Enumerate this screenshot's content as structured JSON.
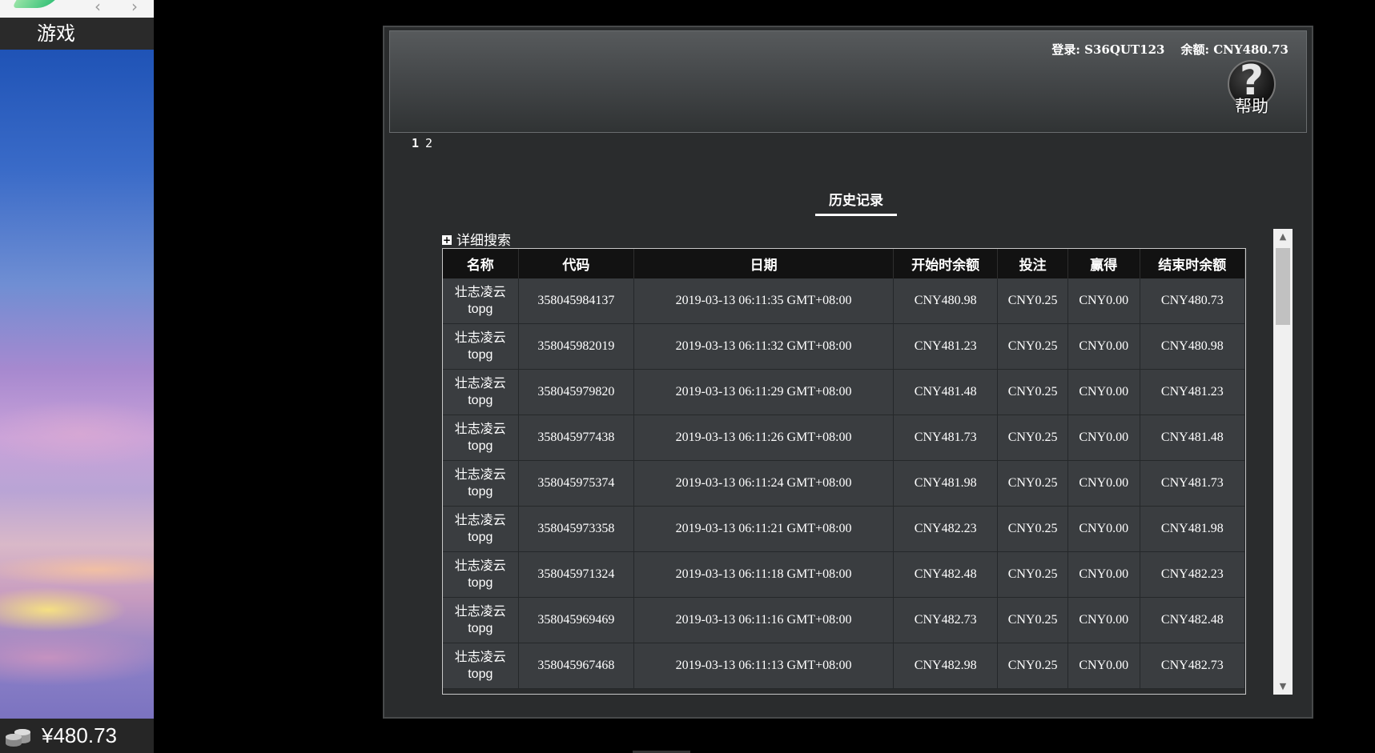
{
  "sidebar": {
    "games_label": "游戏",
    "wallet_balance": "¥480.73",
    "nav_back": "‹",
    "nav_forward": "›"
  },
  "header": {
    "login_label": "登录: S36QUT123",
    "balance_label": "余额: CNY480.73",
    "help_label": "帮助",
    "help_symbol": "?"
  },
  "pager": {
    "pages": [
      "1",
      "2"
    ],
    "current": "1"
  },
  "history": {
    "title": "历史记录",
    "advanced_search": "详细搜索",
    "columns": [
      "名称",
      "代码",
      "日期",
      "开始时余额",
      "投注",
      "赢得",
      "结束时余额"
    ],
    "rows": [
      {
        "name": "壮志凌云",
        "sub": "topg",
        "code": "358045984137",
        "date": "2019-03-13 06:11:35 GMT+08:00",
        "start": "CNY480.98",
        "bet": "CNY0.25",
        "win": "CNY0.00",
        "end": "CNY480.73"
      },
      {
        "name": "壮志凌云",
        "sub": "topg",
        "code": "358045982019",
        "date": "2019-03-13 06:11:32 GMT+08:00",
        "start": "CNY481.23",
        "bet": "CNY0.25",
        "win": "CNY0.00",
        "end": "CNY480.98"
      },
      {
        "name": "壮志凌云",
        "sub": "topg",
        "code": "358045979820",
        "date": "2019-03-13 06:11:29 GMT+08:00",
        "start": "CNY481.48",
        "bet": "CNY0.25",
        "win": "CNY0.00",
        "end": "CNY481.23"
      },
      {
        "name": "壮志凌云",
        "sub": "topg",
        "code": "358045977438",
        "date": "2019-03-13 06:11:26 GMT+08:00",
        "start": "CNY481.73",
        "bet": "CNY0.25",
        "win": "CNY0.00",
        "end": "CNY481.48"
      },
      {
        "name": "壮志凌云",
        "sub": "topg",
        "code": "358045975374",
        "date": "2019-03-13 06:11:24 GMT+08:00",
        "start": "CNY481.98",
        "bet": "CNY0.25",
        "win": "CNY0.00",
        "end": "CNY481.73"
      },
      {
        "name": "壮志凌云",
        "sub": "topg",
        "code": "358045973358",
        "date": "2019-03-13 06:11:21 GMT+08:00",
        "start": "CNY482.23",
        "bet": "CNY0.25",
        "win": "CNY0.00",
        "end": "CNY481.98"
      },
      {
        "name": "壮志凌云",
        "sub": "topg",
        "code": "358045971324",
        "date": "2019-03-13 06:11:18 GMT+08:00",
        "start": "CNY482.48",
        "bet": "CNY0.25",
        "win": "CNY0.00",
        "end": "CNY482.23"
      },
      {
        "name": "壮志凌云",
        "sub": "topg",
        "code": "358045969469",
        "date": "2019-03-13 06:11:16 GMT+08:00",
        "start": "CNY482.73",
        "bet": "CNY0.25",
        "win": "CNY0.00",
        "end": "CNY482.48"
      },
      {
        "name": "壮志凌云",
        "sub": "topg",
        "code": "358045967468",
        "date": "2019-03-13 06:11:13 GMT+08:00",
        "start": "CNY482.98",
        "bet": "CNY0.25",
        "win": "CNY0.00",
        "end": "CNY482.73"
      }
    ]
  },
  "icons": {
    "help": "question-mark-circle-icon",
    "advanced_search": "plus-box-icon",
    "wallet": "coins-stack-icon"
  },
  "colors": {
    "background": "#000000",
    "dialog_bg": "#2a2c2d",
    "table_header_bg": "#121212",
    "table_cell_bg": "#3a3d40",
    "text": "#ffffff"
  }
}
